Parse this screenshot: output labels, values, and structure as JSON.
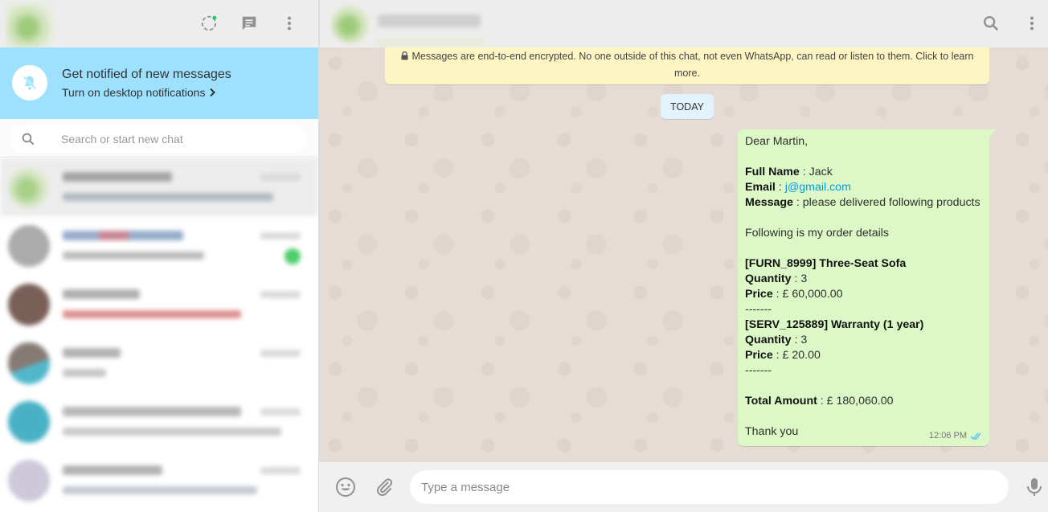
{
  "colors": {
    "header_bg": "#ededed",
    "notification_bg": "#9de1fe",
    "chat_bg": "#e5ddd5",
    "outgoing_bubble": "#dcf8c6",
    "encryption_banner": "#fdf5c4",
    "date_chip": "#e1f3fb",
    "link": "#039be5",
    "icon_gray": "#919191"
  },
  "left_header": {
    "icons": [
      "status-icon",
      "new-chat-icon",
      "menu-icon"
    ]
  },
  "notification": {
    "title": "Get notified of new messages",
    "link": "Turn on desktop notifications"
  },
  "search": {
    "placeholder": "Search or start new chat"
  },
  "conversation": {
    "encryption_notice": "Messages are end-to-end encrypted. No one outside of this chat, not even WhatsApp, can read or listen to them. Click to learn more.",
    "date_label": "TODAY",
    "message": {
      "greeting": "Dear Martin,",
      "full_name_label": "Full Name",
      "full_name_value": " : Jack",
      "email_label": "Email",
      "email_sep": " : ",
      "email_value": "j@gmail.com",
      "message_label": "Message",
      "message_value": " : please delivered following products",
      "order_intro": "Following is my order details",
      "items": [
        {
          "title": "[FURN_8999] Three-Seat Sofa",
          "quantity_label": "Quantity",
          "quantity_value": " : 3",
          "price_label": "Price",
          "price_value": " : £ 60,000.00",
          "separator": "-------"
        },
        {
          "title": "[SERV_125889] Warranty (1 year)",
          "quantity_label": "Quantity",
          "quantity_value": " : 3",
          "price_label": "Price",
          "price_value": " : £ 20.00",
          "separator": "-------"
        }
      ],
      "total_label": "Total Amount",
      "total_value": " : £ 180,060.00",
      "closing": "Thank you",
      "time": "12:06 PM"
    }
  },
  "composer": {
    "placeholder": "Type a message"
  }
}
